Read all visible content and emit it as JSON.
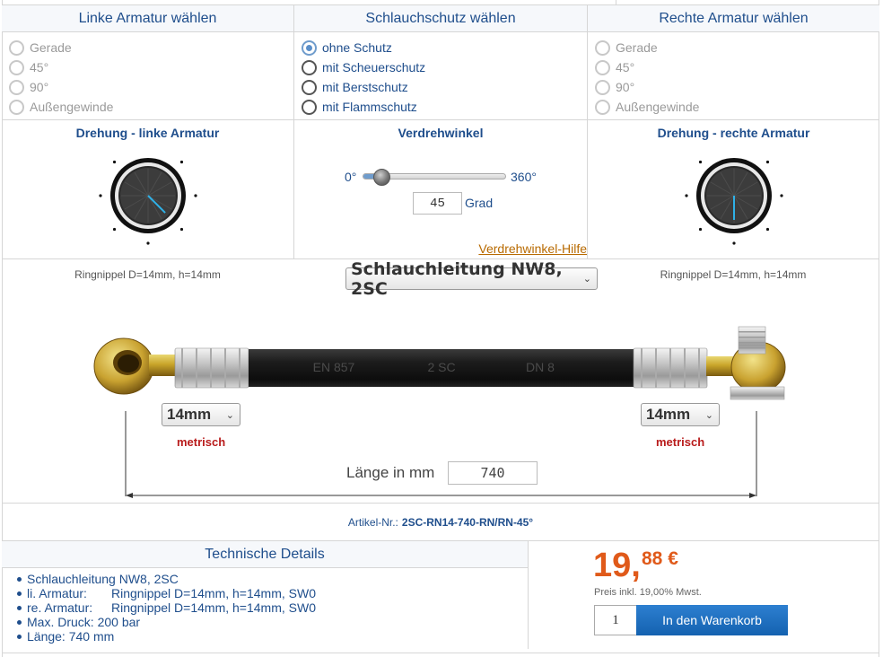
{
  "columns": {
    "left": {
      "title": "Linke Armatur wählen",
      "options": [
        {
          "label": "Gerade",
          "state": "disabled"
        },
        {
          "label": "45°",
          "state": "disabled"
        },
        {
          "label": "90°",
          "state": "disabled"
        },
        {
          "label": "Außengewinde",
          "state": "disabled"
        }
      ]
    },
    "middle": {
      "title": "Schlauchschutz wählen",
      "options": [
        {
          "label": "ohne Schutz",
          "state": "checked"
        },
        {
          "label": "mit Scheuerschutz",
          "state": "enabled"
        },
        {
          "label": "mit Berstschutz",
          "state": "enabled"
        },
        {
          "label": "mit Flammschutz",
          "state": "enabled"
        }
      ]
    },
    "right": {
      "title": "Rechte Armatur wählen",
      "options": [
        {
          "label": "Gerade",
          "state": "disabled"
        },
        {
          "label": "45°",
          "state": "disabled"
        },
        {
          "label": "90°",
          "state": "disabled"
        },
        {
          "label": "Außengewinde",
          "state": "disabled"
        }
      ]
    }
  },
  "rotation": {
    "left_title": "Drehung - linke Armatur",
    "left_angle_deg": 135,
    "middle_title": "Verdrehwinkel",
    "min_label": "0°",
    "max_label": "360°",
    "slider_value": 45,
    "slider_max": 360,
    "degree_value": "45",
    "degree_unit": "Grad",
    "help_link": "Verdrehwinkel-Hilfe",
    "right_title": "Drehung - rechte Armatur",
    "right_angle_deg": 180
  },
  "hose": {
    "nipple_left": "Ringnippel D=14mm, h=14mm",
    "nipple_right": "Ringnippel D=14mm, h=14mm",
    "hose_type": "Schlauchleitung NW8, 2SC",
    "hose_print": [
      "EN 857",
      "2 SC",
      "DN 8"
    ],
    "size_left": "14mm",
    "size_right": "14mm",
    "metric_left": "metrisch",
    "metric_right": "metrisch",
    "length_label": "Länge in mm",
    "length_value": "740"
  },
  "article": {
    "label": "Artikel-Nr.:",
    "number": "2SC-RN14-740-RN/RN-45°"
  },
  "technical": {
    "title": "Technische Details",
    "items": [
      {
        "key": "",
        "value": "Schlauchleitung NW8, 2SC"
      },
      {
        "key": "li. Armatur:",
        "value": "Ringnippel D=14mm, h=14mm, SW0"
      },
      {
        "key": "re. Armatur:",
        "value": "Ringnippel D=14mm, h=14mm, SW0"
      },
      {
        "key": "",
        "value": "Max. Druck: 200 bar"
      },
      {
        "key": "",
        "value": "Länge: 740 mm"
      }
    ]
  },
  "price": {
    "main": "19,",
    "cents": "88 €",
    "vat": "Preis inkl. 19,00% Mwst.",
    "qty": "1",
    "cart_button": "In den Warenkorb"
  },
  "colors": {
    "accent": "#1f4e8c",
    "price": "#e05a1a",
    "metric": "#b91c1c",
    "button": "#1462b0",
    "link": "#b86a00"
  }
}
